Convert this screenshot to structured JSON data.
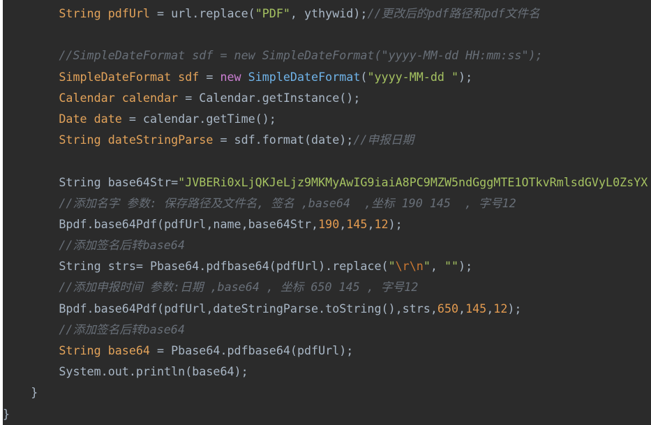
{
  "editor": {
    "lines": [
      {
        "indent": "        ",
        "tokens": [
          {
            "t": "String pdfUrl",
            "k": "type"
          },
          {
            "t": " = url.replace(",
            "k": "plain"
          },
          {
            "t": "\"PDF\"",
            "k": "str"
          },
          {
            "t": ", ythywid);",
            "k": "plain"
          },
          {
            "t": "//更改后的pdf路径和pdf文件名",
            "k": "cmt"
          }
        ]
      },
      {
        "indent": "",
        "tokens": []
      },
      {
        "indent": "        ",
        "tokens": [
          {
            "t": "//SimpleDateFormat sdf = new SimpleDateFormat(\"yyyy-MM-dd HH:mm:ss\");",
            "k": "cmt"
          }
        ]
      },
      {
        "indent": "        ",
        "tokens": [
          {
            "t": "SimpleDateFormat sdf",
            "k": "type"
          },
          {
            "t": " = ",
            "k": "plain"
          },
          {
            "t": "new",
            "k": "kw"
          },
          {
            "t": " ",
            "k": "plain"
          },
          {
            "t": "SimpleDateFormat",
            "k": "cls"
          },
          {
            "t": "(",
            "k": "plain"
          },
          {
            "t": "\"yyyy-MM-dd \"",
            "k": "str"
          },
          {
            "t": ");",
            "k": "plain"
          }
        ]
      },
      {
        "indent": "        ",
        "tokens": [
          {
            "t": "Calendar calendar",
            "k": "type"
          },
          {
            "t": " = Calendar.getInstance();",
            "k": "plain"
          }
        ]
      },
      {
        "indent": "        ",
        "tokens": [
          {
            "t": "Date date",
            "k": "type"
          },
          {
            "t": " = calendar.getTime();",
            "k": "plain"
          }
        ]
      },
      {
        "indent": "        ",
        "tokens": [
          {
            "t": "String dateStringParse",
            "k": "type"
          },
          {
            "t": " = sdf.format(date);",
            "k": "plain"
          },
          {
            "t": "//申报日期",
            "k": "cmt"
          }
        ]
      },
      {
        "indent": "",
        "tokens": []
      },
      {
        "indent": "        ",
        "tokens": [
          {
            "t": "String base64Str=",
            "k": "plain"
          },
          {
            "t": "\"JVBERi0xLjQKJeLjz9MKMyAwIG9iaiA8PC9MZW5ndGggMTE1OTkvRmlsdGVyL0ZsYX",
            "k": "str"
          }
        ]
      },
      {
        "indent": "        ",
        "tokens": [
          {
            "t": "//添加名字 参数: 保存路径及文件名, 签名 ,base64  ,坐标 190 145  , 字号12",
            "k": "cmt"
          }
        ]
      },
      {
        "indent": "        ",
        "tokens": [
          {
            "t": "Bpdf.base64Pdf(pdfUrl,name,base64Str,",
            "k": "plain"
          },
          {
            "t": "190",
            "k": "num"
          },
          {
            "t": ",",
            "k": "plain"
          },
          {
            "t": "145",
            "k": "num"
          },
          {
            "t": ",",
            "k": "plain"
          },
          {
            "t": "12",
            "k": "num"
          },
          {
            "t": ");",
            "k": "plain"
          }
        ]
      },
      {
        "indent": "        ",
        "tokens": [
          {
            "t": "//添加签名后转base64",
            "k": "cmt"
          }
        ]
      },
      {
        "indent": "        ",
        "tokens": [
          {
            "t": "String strs= Pbase64.pdfbase64(pdfUrl).replace(",
            "k": "plain"
          },
          {
            "t": "\"",
            "k": "str"
          },
          {
            "t": "\\r\\n",
            "k": "esc"
          },
          {
            "t": "\"",
            "k": "str"
          },
          {
            "t": ", ",
            "k": "plain"
          },
          {
            "t": "\"\"",
            "k": "str"
          },
          {
            "t": ");",
            "k": "plain"
          }
        ]
      },
      {
        "indent": "        ",
        "tokens": [
          {
            "t": "//添加申报时间 参数:日期 ,base64 , 坐标 650 145 , 字号12",
            "k": "cmt"
          }
        ]
      },
      {
        "indent": "        ",
        "tokens": [
          {
            "t": "Bpdf.base64Pdf(pdfUrl,dateStringParse.toString(),strs,",
            "k": "plain"
          },
          {
            "t": "650",
            "k": "num"
          },
          {
            "t": ",",
            "k": "plain"
          },
          {
            "t": "145",
            "k": "num"
          },
          {
            "t": ",",
            "k": "plain"
          },
          {
            "t": "12",
            "k": "num"
          },
          {
            "t": ");",
            "k": "plain"
          }
        ]
      },
      {
        "indent": "        ",
        "tokens": [
          {
            "t": "//添加签名后转base64",
            "k": "cmt"
          }
        ]
      },
      {
        "indent": "        ",
        "tokens": [
          {
            "t": "String base64",
            "k": "type"
          },
          {
            "t": " = Pbase64.pdfbase64(pdfUrl);",
            "k": "plain"
          }
        ]
      },
      {
        "indent": "        ",
        "tokens": [
          {
            "t": "System.out.println(base64);",
            "k": "plain"
          }
        ]
      },
      {
        "indent": "    ",
        "tokens": [
          {
            "t": "}",
            "k": "plain"
          }
        ]
      },
      {
        "indent": "",
        "tokens": [
          {
            "t": "}",
            "k": "plain"
          }
        ]
      }
    ]
  }
}
